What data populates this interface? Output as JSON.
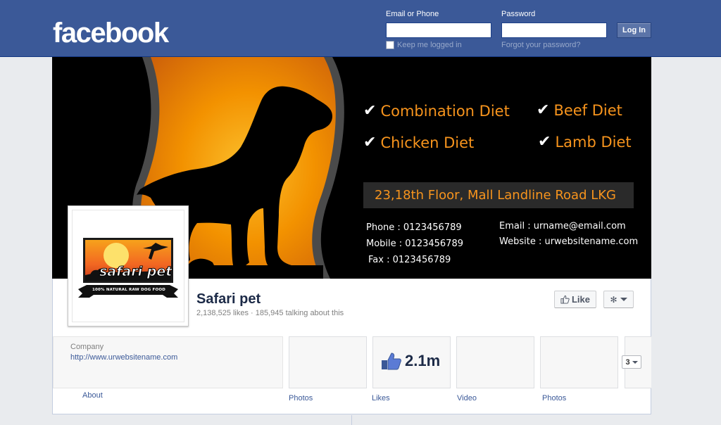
{
  "header": {
    "logo": "facebook",
    "email_label": "Email or Phone",
    "password_label": "Password",
    "login_button": "Log In",
    "keep_logged_in": "Keep me logged in",
    "forgot_password": "Forgot your password?"
  },
  "cover": {
    "diets": [
      "Combination Diet",
      "Beef Diet",
      "Chicken Diet",
      "Lamb Diet"
    ],
    "address": "23,18th Floor, Mall Landline Road LKG",
    "phone": "Phone : 0123456789",
    "mobile": "Mobile : 0123456789",
    "fax": "Fax : 0123456789",
    "email": "Email : urname@email.com",
    "website": "Website : urwebsitename.com"
  },
  "logo_badge": {
    "brand": "safari pet",
    "tagline": "100% NATURAL RAW DOG FOOD"
  },
  "page": {
    "name": "Safari pet",
    "stats": "2,138,525 likes · 185,945 talking about this",
    "like_button": "Like"
  },
  "info": {
    "category": "Company",
    "url": "http://www.urwebsitename.com",
    "about_label": "About"
  },
  "apps": {
    "likes_count": "2.1m",
    "labels": [
      "Photos",
      "Likes",
      "Video",
      "Photos"
    ],
    "more_count": "3"
  },
  "colors": {
    "brand_blue": "#3b5998",
    "orange": "#f7941d"
  }
}
